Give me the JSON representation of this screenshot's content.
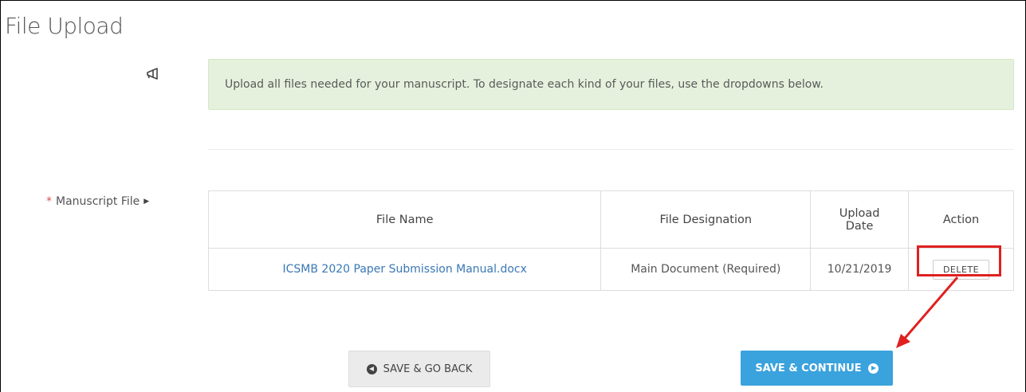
{
  "page": {
    "title": "File Upload"
  },
  "alert": {
    "icon": "megaphone-icon",
    "message": "Upload all files needed for your manuscript. To designate each kind of your files, use the dropdowns below."
  },
  "field": {
    "required_marker": "*",
    "label": "Manuscript File"
  },
  "table": {
    "headers": {
      "file_name": "File Name",
      "designation": "File Designation",
      "upload_date_line1": "Upload",
      "upload_date_line2": "Date",
      "action": "Action"
    },
    "rows": [
      {
        "file_name": "ICSMB 2020 Paper Submission Manual.docx",
        "designation": "Main Document (Required)",
        "upload_date": "10/21/2019",
        "action_label": "DELETE"
      }
    ]
  },
  "buttons": {
    "back_label": "SAVE & GO BACK",
    "continue_label": "SAVE & CONTINUE"
  },
  "colors": {
    "alert_bg": "#e5f1dd",
    "link": "#3a78b5",
    "primary": "#3aa2dc",
    "highlight": "#e02020",
    "required": "#d9534f"
  }
}
